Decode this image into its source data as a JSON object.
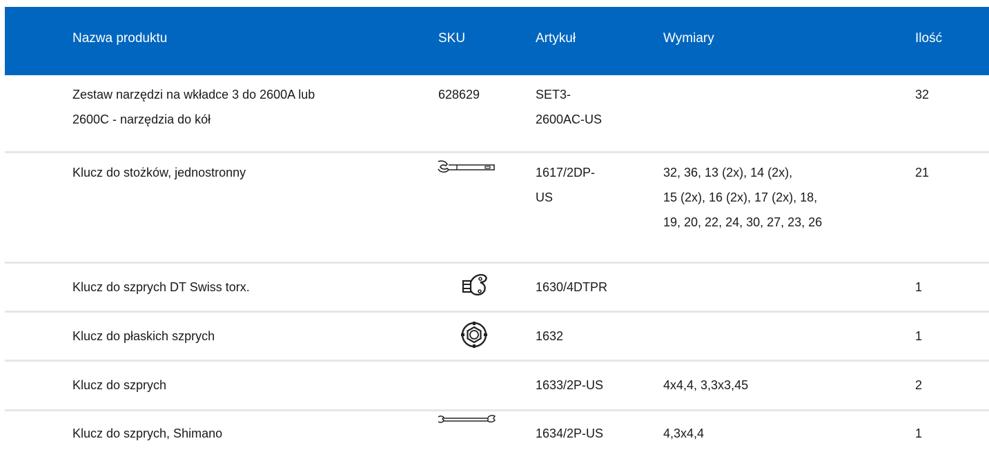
{
  "headers": {
    "name": "Nazwa produktu",
    "sku": "SKU",
    "article": "Artykuł",
    "dimensions": "Wymiary",
    "quantity": "Ilość"
  },
  "rows": [
    {
      "name_l1": "Zestaw narzędzi na wkładce 3 do 2600A lub",
      "name_l2": "2600C - narzędzia do kół",
      "sku": "628629",
      "article_l1": "SET3-",
      "article_l2": "2600AC-US",
      "dim_l1": "",
      "dim_l2": "",
      "dim_l3": "",
      "quantity": "32",
      "icon": ""
    },
    {
      "name_l1": "Klucz do stożków, jednostronny",
      "sku": "",
      "article_l1": "1617/2DP-",
      "article_l2": "US",
      "dim_l1": "32, 36, 13 (2x), 14 (2x),",
      "dim_l2": "15 (2x), 16 (2x), 17 (2x), 18,",
      "dim_l3": "19, 20, 22, 24, 30, 27, 23, 26",
      "quantity": "21",
      "icon": "cone-wrench-icon"
    },
    {
      "name_l1": "Klucz do szprych DT Swiss torx.",
      "sku": "",
      "article_l1": "1630/4DTPR",
      "quantity": "1",
      "icon": "dt-swiss-spoke-key-icon"
    },
    {
      "name_l1": "Klucz do płaskich szprych",
      "sku": "",
      "article_l1": "1632",
      "quantity": "1",
      "icon": "round-spoke-wrench-icon"
    },
    {
      "name_l1": "Klucz do szprych",
      "sku": "",
      "article_l1": "1633/2P-US",
      "dim_l1": "4x4,4, 3,3x3,45",
      "quantity": "2",
      "icon": ""
    },
    {
      "name_l1": "Klucz do szprych, Shimano",
      "sku": "",
      "article_l1": "1634/2P-US",
      "dim_l1": "4,3x4,4",
      "quantity": "1",
      "icon": "double-spoke-wrench-icon"
    }
  ],
  "colors": {
    "header_bg": "#0066bf",
    "header_text": "#ffffff",
    "row_divider": "#e6e6e6",
    "body_text": "#1a1a1a"
  }
}
